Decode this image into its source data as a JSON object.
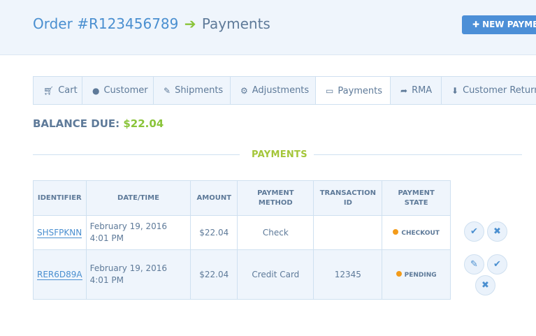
{
  "header": {
    "order_label": "Order #R123456789",
    "page_label": "Payments",
    "new_payment_label": "NEW PAYMENT"
  },
  "tabs": [
    {
      "label": "Cart",
      "icon": "cart-icon"
    },
    {
      "label": "Customer",
      "icon": "user-icon"
    },
    {
      "label": "Shipments",
      "icon": "edit-icon"
    },
    {
      "label": "Adjustments",
      "icon": "cogs-icon"
    },
    {
      "label": "Payments",
      "icon": "credit-card-icon",
      "active": true
    },
    {
      "label": "RMA",
      "icon": "share-icon"
    },
    {
      "label": "Customer Returns",
      "icon": "download-icon"
    }
  ],
  "balance": {
    "label": "BALANCE DUE:",
    "amount": "$22.04"
  },
  "section_title": "PAYMENTS",
  "table": {
    "headers": {
      "identifier": "IDENTIFIER",
      "datetime": "DATE/TIME",
      "amount": "AMOUNT",
      "method": "PAYMENT METHOD",
      "transaction": "TRANSACTION ID",
      "state": "PAYMENT STATE"
    },
    "rows": [
      {
        "identifier": "SHSFPKNN",
        "datetime": "February 19, 2016 4:01 PM",
        "amount": "$22.04",
        "method": "Check",
        "transaction": "",
        "state": "CHECKOUT"
      },
      {
        "identifier": "RER6D89A",
        "datetime": "February 19, 2016 4:01 PM",
        "amount": "$22.04",
        "method": "Credit Card",
        "transaction": "12345",
        "state": "PENDING"
      }
    ]
  },
  "colors": {
    "accent_blue": "#4a8fd0",
    "accent_green": "#8ac43a",
    "state_dot": "#f39b1a"
  }
}
